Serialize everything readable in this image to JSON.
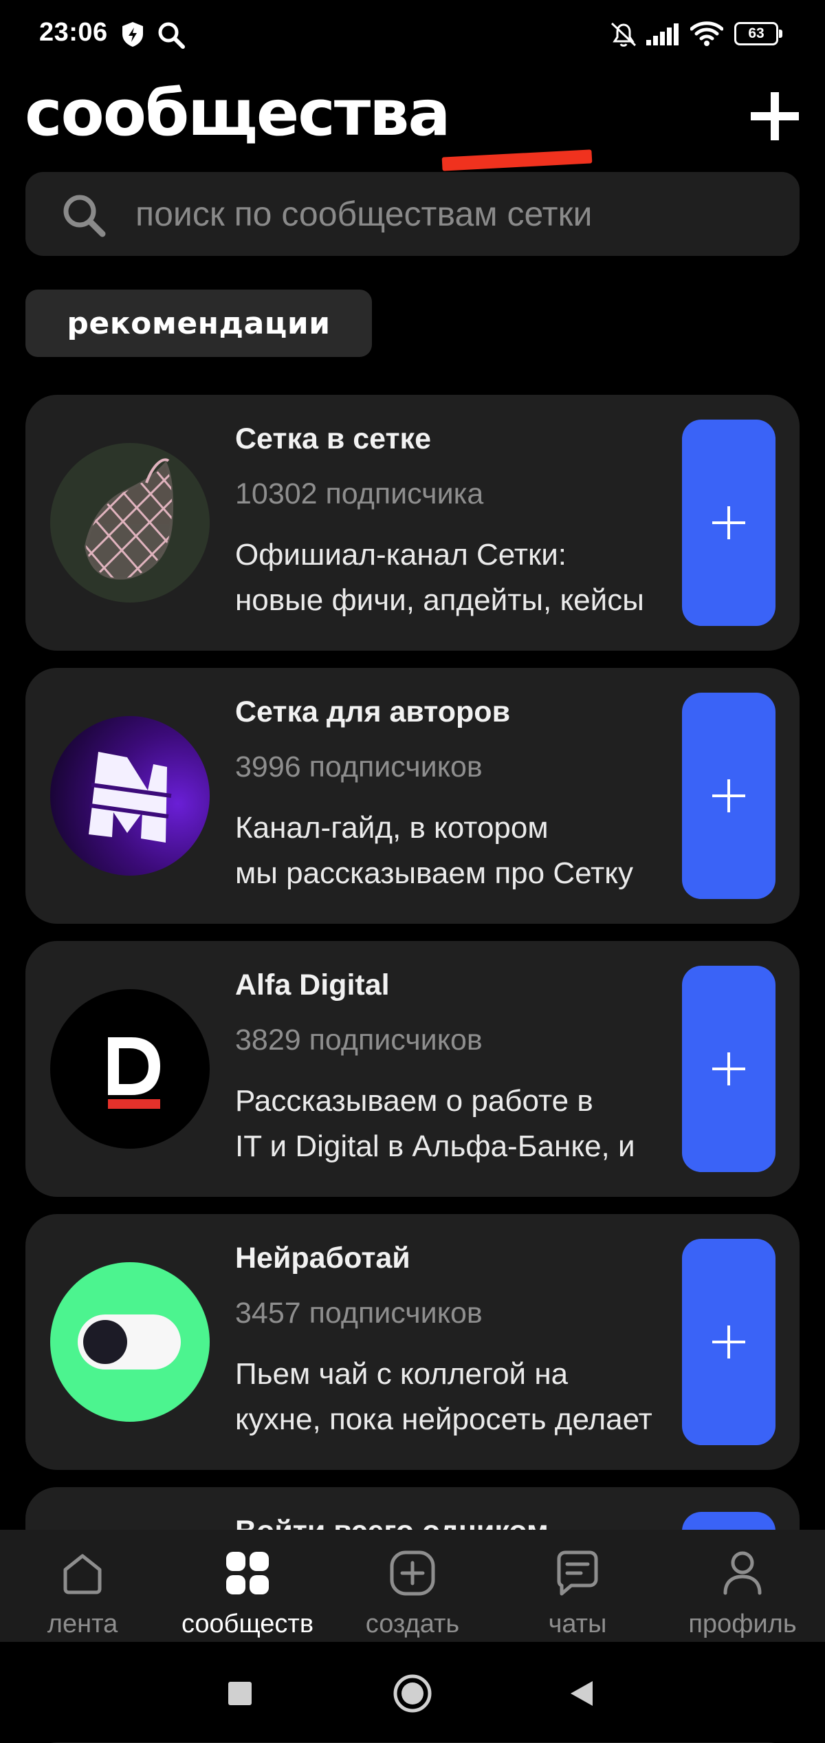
{
  "status_bar": {
    "time": "23:06",
    "battery": "63",
    "icons": [
      "shield-icon",
      "search-icon",
      "mute-icon",
      "signal-icon",
      "wifi-icon",
      "battery-icon"
    ]
  },
  "header": {
    "title": "сообщества",
    "add_icon": "plus-icon"
  },
  "search": {
    "placeholder": "поиск по сообществам сетки",
    "icon": "search-icon"
  },
  "filter_chip": {
    "label": "рекомендации"
  },
  "communities": [
    {
      "name": "Сетка в сетке",
      "subscribers": "10302 подписчика",
      "desc_line1": "Офишиал-канал Сетки:",
      "desc_line2": "новые фичи, апдейты, кейсы",
      "avatar": "net-bag-logo"
    },
    {
      "name": "Сетка для авторов",
      "subscribers": "3996 подписчиков",
      "desc_line1": "Канал-гайд, в котором",
      "desc_line2": "мы рассказываем про Сетку",
      "avatar": "m-letter-logo"
    },
    {
      "name": "Alfa Digital",
      "subscribers": "3829 подписчиков",
      "desc_line1": "Рассказываем о работе в",
      "desc_line2": "IT и Digital в Альфа-Банке, и",
      "avatar": "alfa-digital-logo"
    },
    {
      "name": "Нейработай",
      "subscribers": "3457 подписчиков",
      "desc_line1": "Пьем чай с коллегой на",
      "desc_line2": "кухне, пока нейросеть делает",
      "avatar": "toggle-logo"
    },
    {
      "name": "Войти всего одником",
      "subscribers": "",
      "desc_line1": "",
      "desc_line2": "",
      "avatar": ""
    }
  ],
  "bottom_nav": [
    {
      "label": "лента",
      "icon": "home-icon",
      "active": false
    },
    {
      "label": "сообществ",
      "icon": "grid-icon",
      "active": true
    },
    {
      "label": "создать",
      "icon": "add-square-icon",
      "active": false
    },
    {
      "label": "чаты",
      "icon": "chat-icon",
      "active": false
    },
    {
      "label": "профиль",
      "icon": "profile-icon",
      "active": false
    }
  ],
  "colors": {
    "accent": "#3a63f7",
    "card": "#202020",
    "annotation_red": "#f0321e",
    "background": "#000000"
  }
}
